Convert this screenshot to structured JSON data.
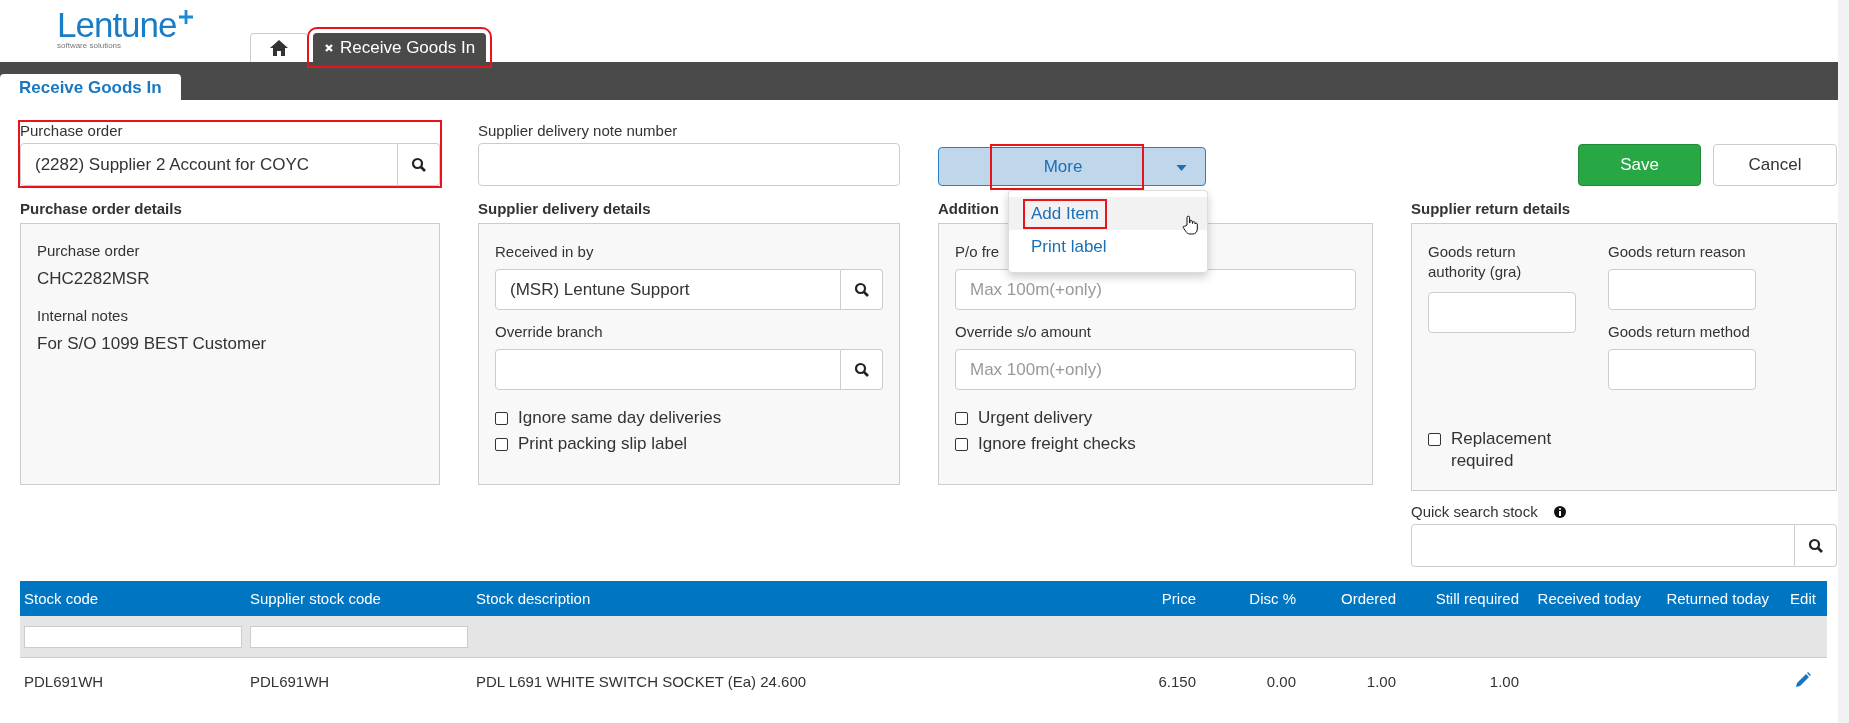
{
  "logo": {
    "name": "Lentune",
    "tagline": "software solutions"
  },
  "top_tabs": [
    {
      "kind": "home",
      "selected": false,
      "highlighted": false
    },
    {
      "kind": "page",
      "label": "Receive Goods In",
      "selected": true,
      "highlighted": true
    }
  ],
  "page_tab": {
    "label": "Receive Goods In",
    "selected": true
  },
  "purchase_order": {
    "label": "Purchase order",
    "value": "(2282) Supplier 2 Account for COYC",
    "highlighted": true
  },
  "delivery_note": {
    "label": "Supplier delivery note number"
  },
  "more_button": {
    "label": "More",
    "highlighted": true,
    "expanded": true,
    "menu": [
      {
        "label": "Add Item",
        "selected": true,
        "highlighted": true
      },
      {
        "label": "Print label",
        "selected": false,
        "highlighted": false
      }
    ]
  },
  "save_button": "Save",
  "cancel_button": "Cancel",
  "po_details": {
    "heading": "Purchase order details",
    "items": [
      {
        "label": "Purchase order",
        "value": "CHC2282MSR"
      },
      {
        "label": "Internal notes",
        "value": "For S/O 1099 BEST Customer"
      }
    ]
  },
  "delivery_details": {
    "heading": "Supplier delivery details",
    "fields": [
      {
        "label": "Received in by",
        "value": "(MSR) Lentune Support"
      },
      {
        "label": "Override branch"
      }
    ],
    "checks": [
      {
        "label": "Ignore same day deliveries",
        "checked": false
      },
      {
        "label": "Print packing slip label",
        "checked": false
      }
    ]
  },
  "additional": {
    "heading": "Addition",
    "fields": [
      {
        "label": "P/o fre",
        "placeholder": "Max 100m(+only)"
      },
      {
        "label": "Override s/o amount",
        "placeholder": "Max 100m(+only)"
      }
    ],
    "checks": [
      {
        "label": "Urgent delivery",
        "checked": false
      },
      {
        "label": "Ignore freight checks",
        "checked": false
      }
    ]
  },
  "return_details": {
    "heading": "Supplier return details",
    "authority_label": "Goods return authority (gra)",
    "reason_label": "Goods return reason",
    "method_label": "Goods return method",
    "replacement": {
      "label": "Replacement required",
      "checked": false
    }
  },
  "quick_search": {
    "label": "Quick search stock"
  },
  "table": {
    "columns": [
      "Stock code",
      "Supplier stock code",
      "Stock description",
      "Price",
      "Disc %",
      "Ordered",
      "Still required",
      "Received today",
      "Returned today",
      "Edit"
    ],
    "rows": [
      {
        "cells": [
          "PDL691WH",
          "PDL691WH",
          "PDL L691 WHITE SWITCH SOCKET (Ea) 24.600",
          "6.150",
          "0.00",
          "1.00",
          "1.00"
        ],
        "editable": true
      }
    ]
  }
}
